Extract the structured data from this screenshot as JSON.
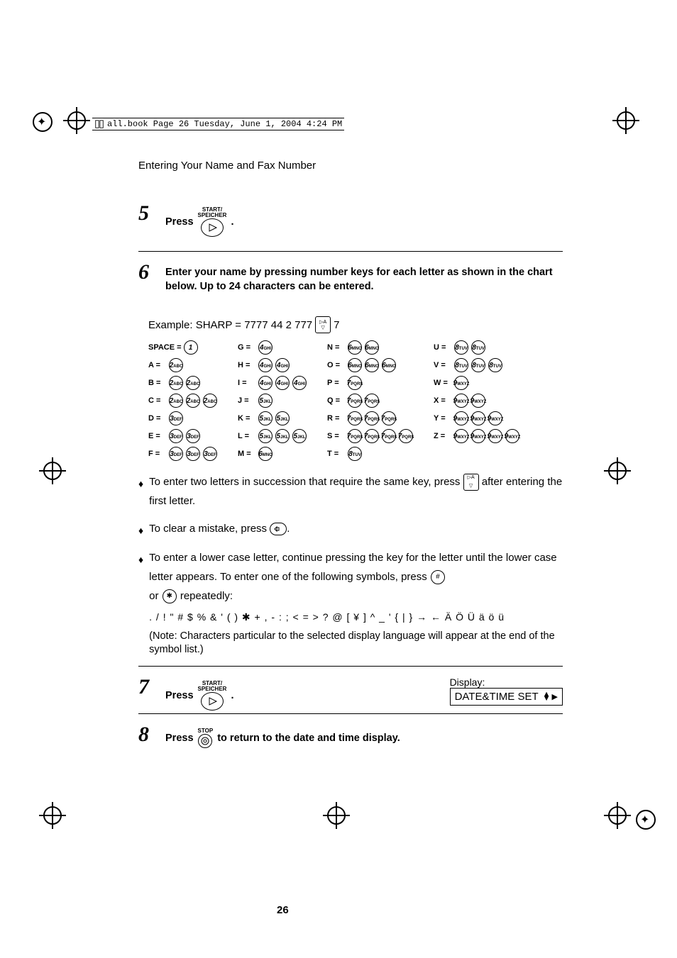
{
  "pageInfo": "all.book  Page 26  Tuesday, June 1, 2004  4:24 PM",
  "sectionTitle": "Entering Your Name and Fax Number",
  "steps": {
    "s5": {
      "num": "5",
      "startLabel": "START/\nSPEICHER",
      "pressText": "Press",
      "dot": "."
    },
    "s6": {
      "num": "6",
      "text": "Enter your name by pressing number keys for each letter as shown in the chart below. Up to 24 characters can be entered.",
      "example": "Example: SHARP = 7777  44  2  777",
      "exampleTail": "7"
    },
    "s7": {
      "num": "7",
      "startLabel": "START/\nSPEICHER",
      "pressText": "Press",
      "dot": ".",
      "displayLabel": "Display:",
      "displayValue": "DATE&TIME SET"
    },
    "s8": {
      "num": "8",
      "stopLabel": "STOP",
      "pressText": "Press",
      "tail": "to return to the date and time display."
    }
  },
  "charTable": {
    "col1": [
      {
        "label": "SPACE =",
        "keys": [
          "1"
        ]
      },
      {
        "label": "A =",
        "keys": [
          "2"
        ]
      },
      {
        "label": "B =",
        "keys": [
          "2",
          "2"
        ]
      },
      {
        "label": "C =",
        "keys": [
          "2",
          "2",
          "2"
        ]
      },
      {
        "label": "D =",
        "keys": [
          "3"
        ]
      },
      {
        "label": "E =",
        "keys": [
          "3",
          "3"
        ]
      },
      {
        "label": "F =",
        "keys": [
          "3",
          "3",
          "3"
        ]
      }
    ],
    "col2": [
      {
        "label": "G =",
        "keys": [
          "4"
        ]
      },
      {
        "label": "H =",
        "keys": [
          "4",
          "4"
        ]
      },
      {
        "label": "I =",
        "keys": [
          "4",
          "4",
          "4"
        ]
      },
      {
        "label": "J =",
        "keys": [
          "5"
        ]
      },
      {
        "label": "K =",
        "keys": [
          "5",
          "5"
        ]
      },
      {
        "label": "L =",
        "keys": [
          "5",
          "5",
          "5"
        ]
      },
      {
        "label": "M =",
        "keys": [
          "6"
        ]
      }
    ],
    "col3": [
      {
        "label": "N =",
        "keys": [
          "6",
          "6"
        ]
      },
      {
        "label": "O =",
        "keys": [
          "6",
          "6",
          "6"
        ]
      },
      {
        "label": "P =",
        "keys": [
          "7"
        ]
      },
      {
        "label": "Q =",
        "keys": [
          "7",
          "7"
        ]
      },
      {
        "label": "R =",
        "keys": [
          "7",
          "7",
          "7"
        ]
      },
      {
        "label": "S =",
        "keys": [
          "7",
          "7",
          "7",
          "7"
        ]
      },
      {
        "label": "T =",
        "keys": [
          "8"
        ]
      }
    ],
    "col4": [
      {
        "label": "U =",
        "keys": [
          "8",
          "8"
        ]
      },
      {
        "label": "V =",
        "keys": [
          "8",
          "8",
          "8"
        ]
      },
      {
        "label": "W =",
        "keys": [
          "9"
        ]
      },
      {
        "label": "X =",
        "keys": [
          "9",
          "9"
        ]
      },
      {
        "label": "Y =",
        "keys": [
          "9",
          "9",
          "9"
        ]
      },
      {
        "label": "Z =",
        "keys": [
          "9",
          "9",
          "9",
          "9"
        ]
      }
    ]
  },
  "tips": {
    "t1a": "To enter two letters in succession that require the same key, press",
    "t1b": "after entering the first letter.",
    "t2a": "To clear a mistake, press",
    "t2b": ".",
    "t3a": "To enter a lower case letter, continue pressing the key for the letter until the lower case letter appears. To enter one of the following symbols, press",
    "t3or": "or",
    "t3rep": "repeatedly:",
    "symbols": ". / ! \" # $ % & ' ( ) ✱ + , - : ; < = > ? @ [ ¥ ] ^ _ ' { | } → ← Ä Ö Ü ä ö ü",
    "note": "(Note: Characters particular to the selected display language will appear at the end of the symbol list.)"
  },
  "pageNumber": "26",
  "icons": {
    "hash": "#",
    "star": "✱",
    "arrowSym": "▶A"
  }
}
